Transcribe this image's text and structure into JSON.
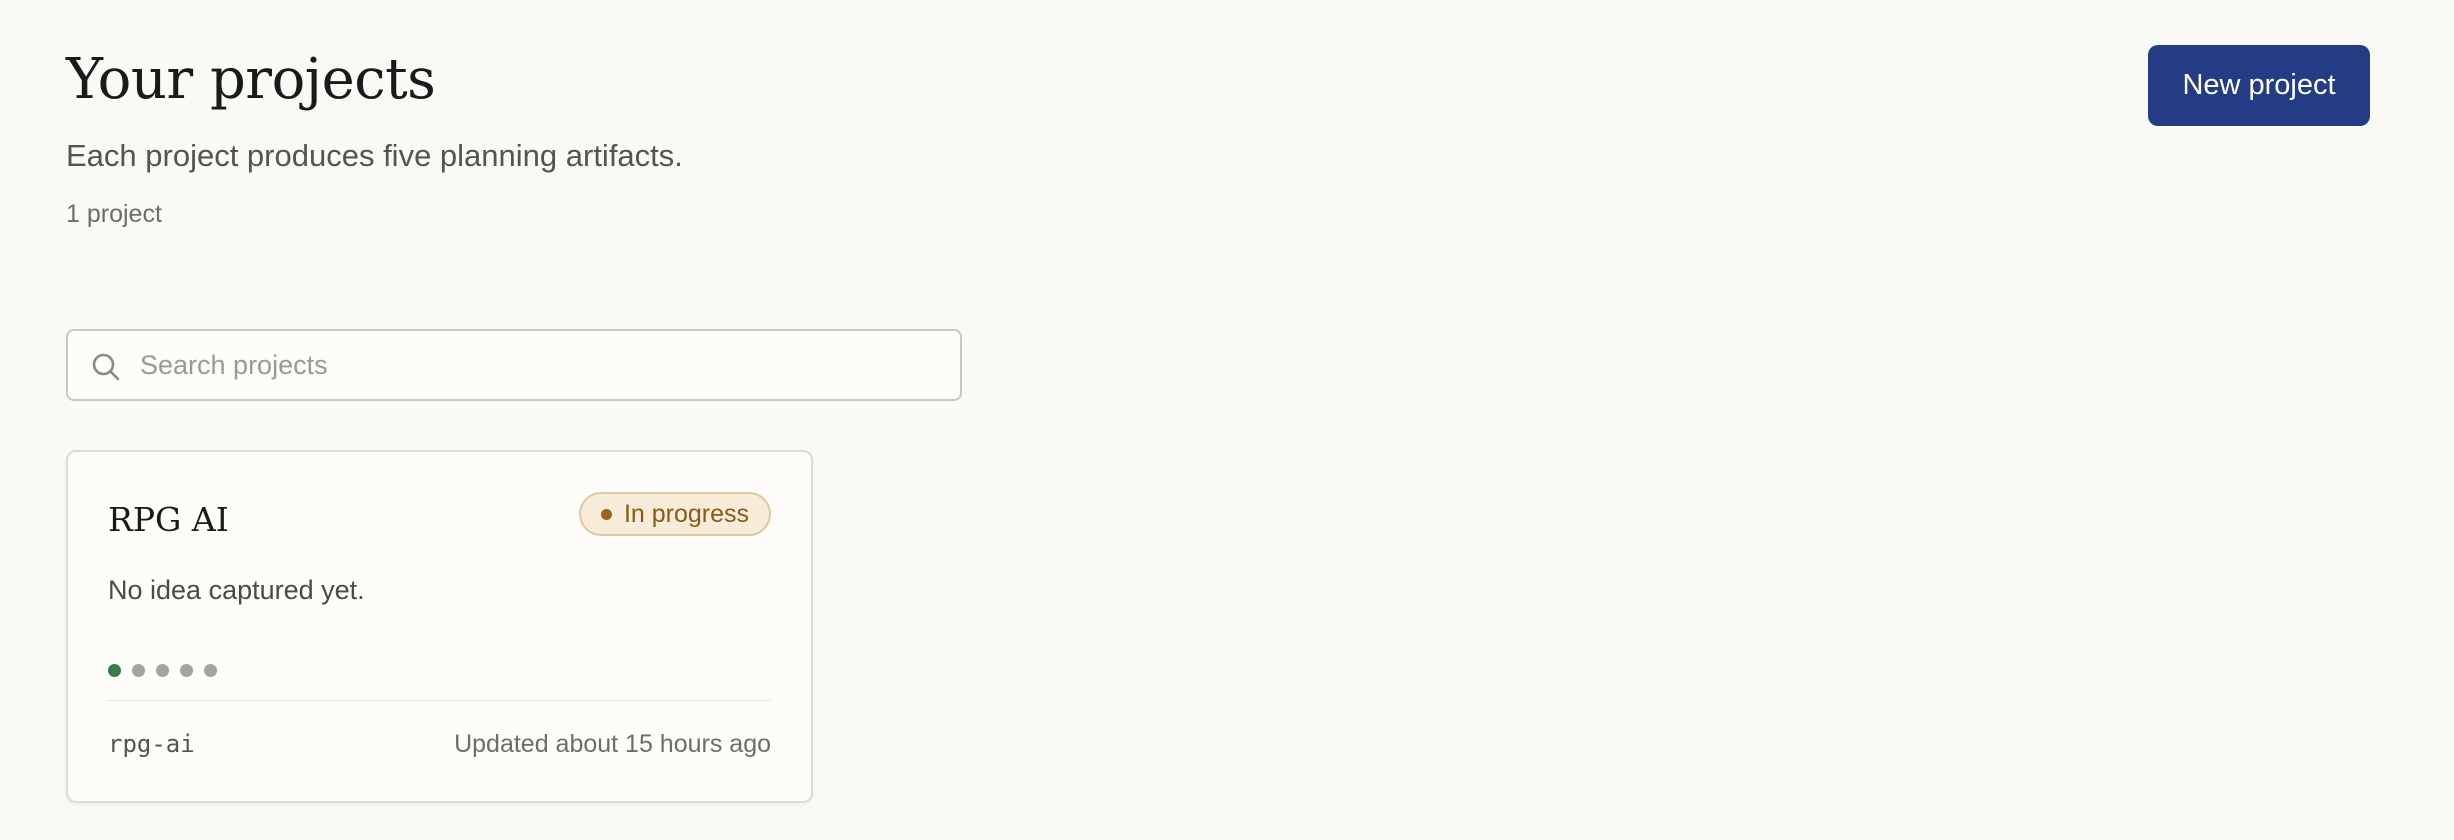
{
  "header": {
    "title": "Your projects",
    "subtitle": "Each project produces five planning artifacts.",
    "count": "1 project",
    "new_project_label": "New project"
  },
  "search": {
    "placeholder": "Search projects",
    "value": "",
    "icon": "search-icon"
  },
  "projects": [
    {
      "title": "RPG AI",
      "status": "In progress",
      "description": "No idea captured yet.",
      "artifacts_total": 5,
      "artifacts_complete": 1,
      "slug": "rpg-ai",
      "updated": "Updated about 15 hours ago"
    }
  ],
  "colors": {
    "primary": "#243b85",
    "background": "#f9f9f5",
    "status_in_progress": "#8a5a17",
    "status_badge_bg": "#f6ecd9",
    "artifact_complete": "#3a7a4a",
    "artifact_pending": "#a3a39f"
  }
}
